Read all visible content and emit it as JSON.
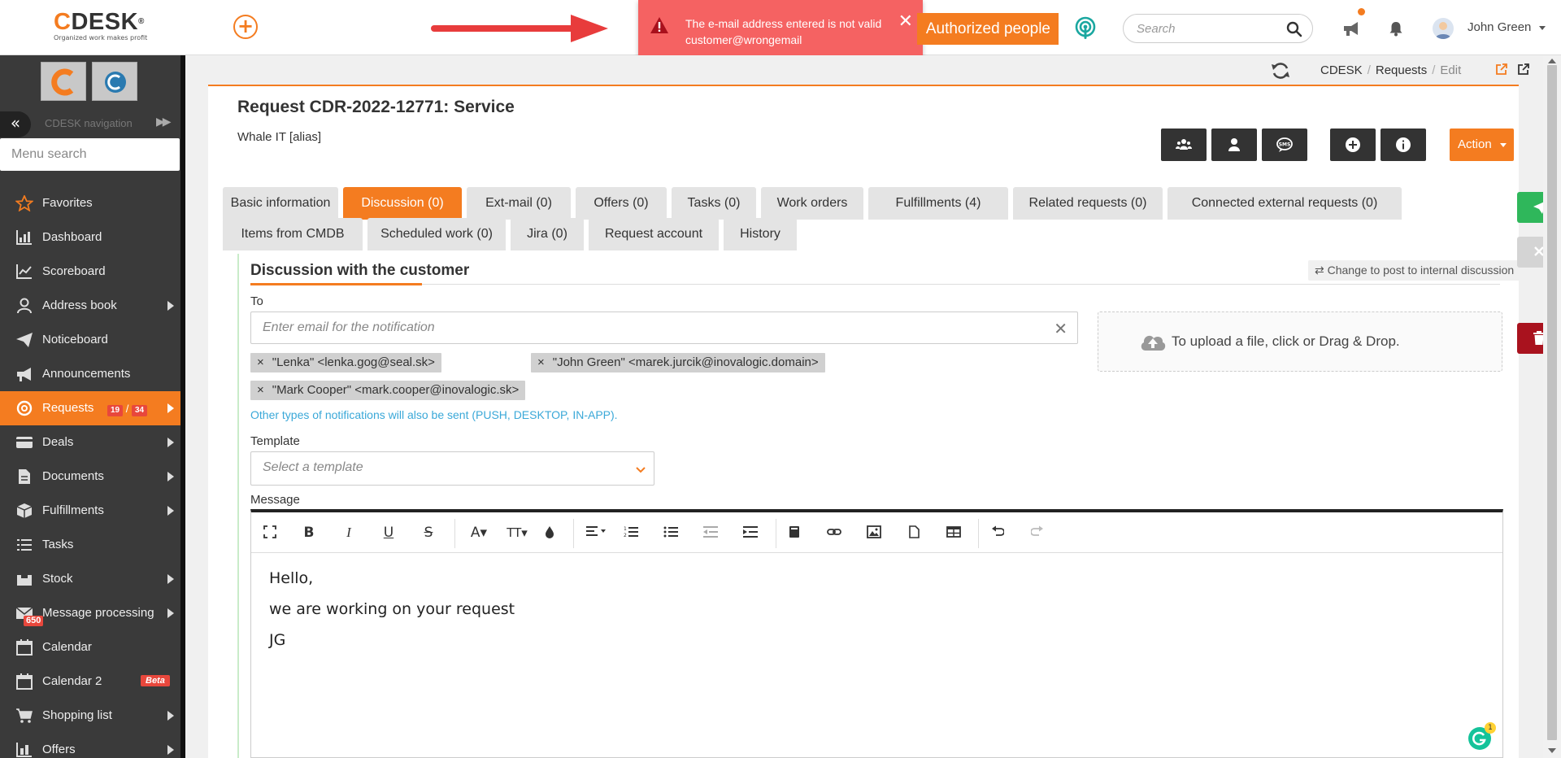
{
  "header": {
    "logo_text": "DESK",
    "logo_letter": "C",
    "logo_reg": "®",
    "logo_tagline": "Organized work makes profit",
    "toast_message": "The e-mail address entered is not valid customer@wrongemail",
    "authorized_label": "Authorized people",
    "search_placeholder": "Search",
    "user_name": "John Green"
  },
  "sidebar": {
    "nav_label": "CDESK navigation",
    "menu_search_placeholder": "Menu search",
    "items": [
      {
        "label": "Favorites",
        "icon": "star-icon"
      },
      {
        "label": "Dashboard",
        "icon": "bar-chart-icon"
      },
      {
        "label": "Scoreboard",
        "icon": "line-chart-icon"
      },
      {
        "label": "Address book",
        "icon": "person-icon"
      },
      {
        "label": "Noticeboard",
        "icon": "paper-plane-icon"
      },
      {
        "label": "Announcements",
        "icon": "megaphone-icon"
      },
      {
        "label": "Requests",
        "icon": "lifebuoy-icon",
        "badge_a": "19",
        "badge_sep": "/",
        "badge_b": "34"
      },
      {
        "label": "Deals",
        "icon": "card-icon"
      },
      {
        "label": "Documents",
        "icon": "document-icon"
      },
      {
        "label": "Fulfillments",
        "icon": "cube-icon"
      },
      {
        "label": "Tasks",
        "icon": "list-icon"
      },
      {
        "label": "Stock",
        "icon": "stock-icon"
      },
      {
        "label": "Message processing",
        "icon": "envelope-icon",
        "badge": "650"
      },
      {
        "label": "Calendar",
        "icon": "calendar-icon"
      },
      {
        "label": "Calendar 2",
        "icon": "calendar-icon",
        "beta": "Beta"
      },
      {
        "label": "Shopping list",
        "icon": "cart-icon"
      },
      {
        "label": "Offers",
        "icon": "offers-icon"
      }
    ]
  },
  "breadcrumb": {
    "root": "CDESK",
    "section": "Requests",
    "page": "Edit",
    "sep": "/"
  },
  "request": {
    "title": "Request CDR-2022-12771: Service",
    "customer": "Whale IT [alias]",
    "action_label": "Action"
  },
  "tabs": [
    "Basic information",
    "Discussion (0)",
    "Ext-mail (0)",
    "Offers (0)",
    "Tasks (0)",
    "Work orders",
    "Fulfillments (4)",
    "Related requests (0)",
    "Connected external requests (0)",
    "Items from CMDB",
    "Scheduled work (0)",
    "Jira (0)",
    "Request account",
    "History"
  ],
  "discussion": {
    "title": "Discussion with the customer",
    "change_label": "Change to post to internal discussion",
    "to_label": "To",
    "to_placeholder": "Enter email for the notification",
    "recipients": [
      "\"Lenka\" <lenka.gog@seal.sk>",
      "\"John Green\" <marek.jurcik@inovalogic.domain>",
      "\"Mark Cooper\" <mark.cooper@inovalogic.sk>"
    ],
    "chip_remove": "×",
    "notif_note": "Other types of notifications will also be sent (PUSH, DESKTOP, IN-APP).",
    "upload_text": "To upload a file, click or Drag & Drop.",
    "template_label": "Template",
    "template_placeholder": "Select a template",
    "message_label": "Message",
    "message_lines": [
      "Hello,",
      "we are working on your request",
      "JG"
    ],
    "grammarly_count": "1"
  },
  "toolbar_glyphs": {
    "bold": "B",
    "italic": "I",
    "underline": "U",
    "strike": "S",
    "font": "A",
    "size": "TT"
  },
  "colors": {
    "accent": "#f47c20",
    "toast": "#f56262",
    "sidebar": "#3a3a3a",
    "link": "#3aa8d8",
    "send": "#2fb75b",
    "delete": "#a9121e"
  }
}
